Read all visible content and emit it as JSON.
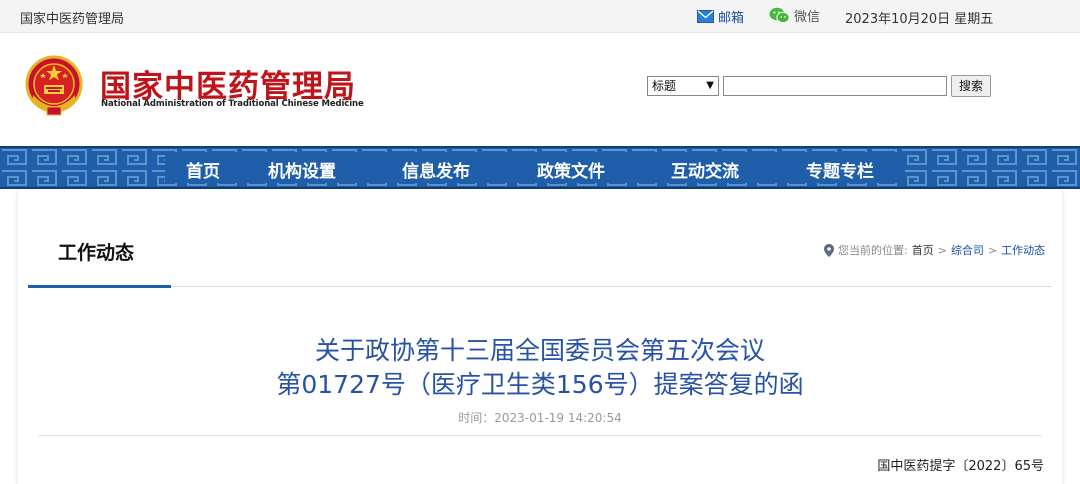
{
  "topbar": {
    "site_name": "国家中医药管理局",
    "mail_label": "邮箱",
    "wechat_label": "微信",
    "date": "2023年10月20日 星期五"
  },
  "header": {
    "logo_cn": "国家中医药管理局",
    "logo_en": "National Administration of Traditional Chinese Medicine",
    "search": {
      "selected_option": "标题",
      "input_value": "",
      "button_label": "搜索"
    }
  },
  "nav": {
    "items": [
      "首页",
      "机构设置",
      "信息发布",
      "政策文件",
      "互动交流",
      "专题专栏"
    ]
  },
  "column": {
    "title": "工作动态",
    "breadcrumb": {
      "prefix": "您当前的位置:",
      "items": [
        "首页",
        "综合司",
        "工作动态"
      ],
      "separator": ">"
    }
  },
  "article": {
    "title_line1": "关于政协第十三届全国委员会第五次会议",
    "title_line2": "第01727号（医疗卫生类156号）提案答复的函",
    "time": "时间：2023-01-19 14:20:54",
    "doc_number": "国中医药提字〔2022〕65号"
  },
  "colors": {
    "nav_blue": "#1f5ea8",
    "title_blue": "#2752a6",
    "logo_red": "#c0141b"
  },
  "icons": {
    "mail": "mail-icon",
    "wechat": "wechat-icon",
    "location": "location-pin-icon",
    "emblem": "national-emblem-icon"
  }
}
